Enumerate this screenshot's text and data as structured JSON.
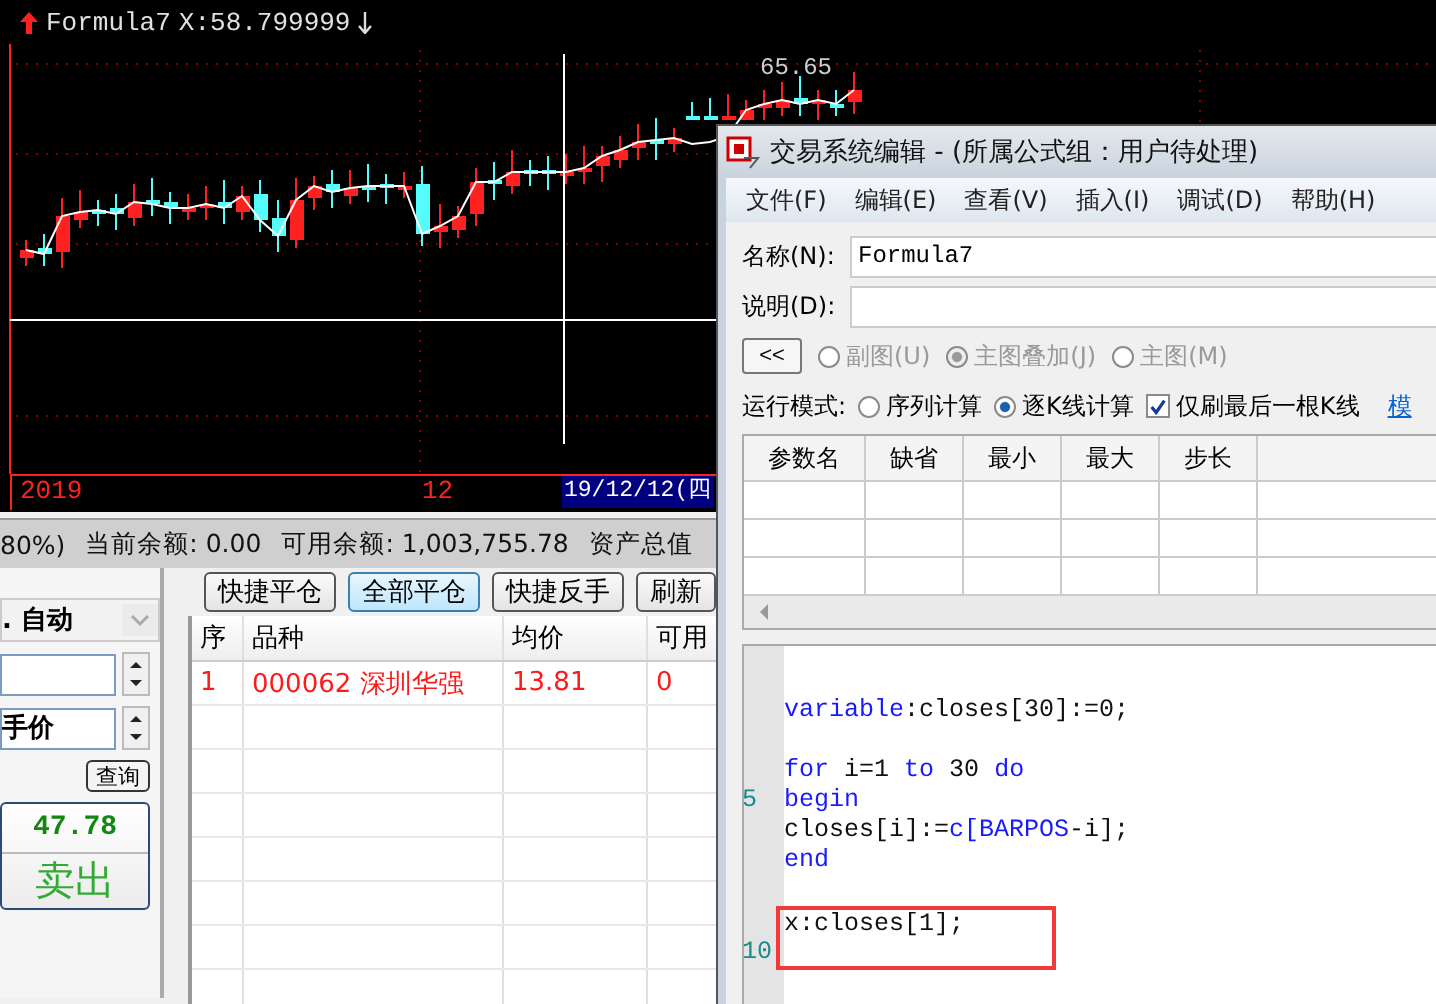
{
  "chart": {
    "indicator": "Formula7",
    "reading": "X:58.799999",
    "price_label": "65.65",
    "axis_labels": [
      {
        "text": "2019",
        "kind": "year"
      },
      {
        "text": "12",
        "kind": "month"
      },
      {
        "text": "19/12/12(四",
        "kind": "cursor"
      }
    ]
  },
  "account_bar": {
    "items": [
      "80%)",
      "当前余额: 0.00",
      "可用余额: 1,003,755.78",
      "资产总值"
    ]
  },
  "order_panel": {
    "mode_select": ". 自动",
    "price_type": "手价",
    "query_button": "查询",
    "sell_price": "47.78",
    "sell_label": "卖出"
  },
  "positions": {
    "buttons": [
      {
        "label": "快捷平仓",
        "selected": false
      },
      {
        "label": "全部平仓",
        "selected": true
      },
      {
        "label": "快捷反手",
        "selected": false
      },
      {
        "label": "刷新",
        "selected": false
      }
    ],
    "columns": [
      "序",
      "品种",
      "均价",
      "可用"
    ],
    "rows": [
      [
        "1",
        "000062 深圳华强",
        "13.81",
        "0"
      ]
    ]
  },
  "dialog": {
    "title": "交易系统编辑 - (所属公式组：用户待处理)",
    "menu": [
      "文件(F)",
      "编辑(E)",
      "查看(V)",
      "插入(I)",
      "调试(D)",
      "帮助(H)"
    ],
    "name_label": "名称(N):",
    "name_value": "Formula7",
    "desc_label": "说明(D):",
    "collapse_button": "<<",
    "chart_options_disabled": true,
    "chart_options": [
      {
        "label": "副图(U)",
        "selected": false
      },
      {
        "label": "主图叠加(J)",
        "selected": true
      },
      {
        "label": "主图(M)",
        "selected": false
      }
    ],
    "run_mode_label": "运行模式:",
    "run_modes": [
      {
        "label": "序列计算",
        "selected": false
      },
      {
        "label": "逐K线计算",
        "selected": true
      }
    ],
    "refresh_last": {
      "label": "仅刷最后一根K线",
      "checked": true
    },
    "link": "模",
    "param_columns": [
      "参数名",
      "缺省",
      "最小",
      "最大",
      "步长"
    ],
    "code_lines": [
      {
        "kind": "blank"
      },
      {
        "kind": "code",
        "tokens": [
          {
            "text": "variable",
            "kind": "keyword"
          },
          {
            "text": ":closes[30]:=0;",
            "kind": "plain"
          }
        ]
      },
      {
        "kind": "blank"
      },
      {
        "kind": "code",
        "tokens": [
          {
            "text": "for",
            "kind": "keyword"
          },
          {
            "text": " i=1 ",
            "kind": "plain"
          },
          {
            "text": "to",
            "kind": "keyword"
          },
          {
            "text": " 30 ",
            "kind": "plain"
          },
          {
            "text": "do",
            "kind": "keyword"
          }
        ]
      },
      {
        "kind": "code",
        "number": "5",
        "tokens": [
          {
            "text": "begin",
            "kind": "keyword"
          }
        ]
      },
      {
        "kind": "code",
        "tokens": [
          {
            "text": "closes[i]:=",
            "kind": "plain"
          },
          {
            "text": "c[BARPOS",
            "kind": "keyword"
          },
          {
            "text": "-i];",
            "kind": "plain"
          }
        ]
      },
      {
        "kind": "code",
        "tokens": [
          {
            "text": "end",
            "kind": "keyword"
          }
        ]
      },
      {
        "kind": "blank"
      }
    ],
    "boxed_lines": [
      {
        "kind": "code",
        "tokens": [
          {
            "text": "x:closes[1];",
            "kind": "plain"
          }
        ]
      },
      {
        "kind": "blank",
        "number": "10"
      }
    ]
  }
}
